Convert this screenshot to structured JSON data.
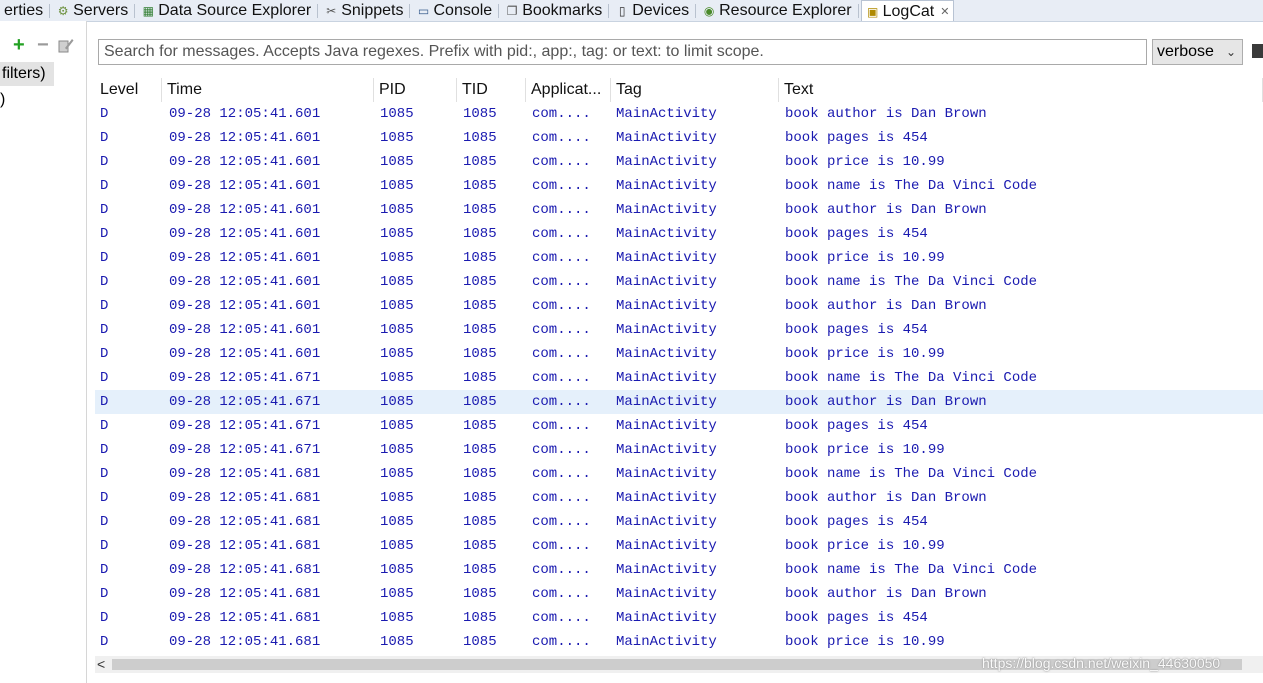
{
  "tabs": [
    {
      "label": "erties",
      "icon": "properties-icon"
    },
    {
      "label": "Servers",
      "icon": "servers-icon"
    },
    {
      "label": "Data Source Explorer",
      "icon": "data-source-icon"
    },
    {
      "label": "Snippets",
      "icon": "snippets-icon"
    },
    {
      "label": "Console",
      "icon": "console-icon"
    },
    {
      "label": "Bookmarks",
      "icon": "bookmarks-icon"
    },
    {
      "label": "Devices",
      "icon": "devices-icon"
    },
    {
      "label": "Resource Explorer",
      "icon": "resource-explorer-icon"
    },
    {
      "label": "LogCat",
      "icon": "logcat-icon",
      "active": true,
      "close": "✕"
    }
  ],
  "left_pane": {
    "add_label": "+",
    "remove_label": "−",
    "filters": [
      " filters)",
      ")"
    ]
  },
  "search": {
    "placeholder": "Search for messages. Accepts Java regexes. Prefix with pid:, app:, tag: or text: to limit scope."
  },
  "level_select": {
    "value": "verbose",
    "options": [
      "verbose"
    ]
  },
  "table": {
    "columns": [
      "Level",
      "Time",
      "PID",
      "TID",
      "Applicat...",
      "Tag",
      "Text"
    ],
    "selected_row": 12,
    "rows": [
      [
        "D",
        "09-28 12:05:41.601",
        "1085",
        "1085",
        "com....",
        "MainActivity",
        "book author is Dan Brown"
      ],
      [
        "D",
        "09-28 12:05:41.601",
        "1085",
        "1085",
        "com....",
        "MainActivity",
        "book pages is 454"
      ],
      [
        "D",
        "09-28 12:05:41.601",
        "1085",
        "1085",
        "com....",
        "MainActivity",
        "book price is 10.99"
      ],
      [
        "D",
        "09-28 12:05:41.601",
        "1085",
        "1085",
        "com....",
        "MainActivity",
        "book name is The Da Vinci Code"
      ],
      [
        "D",
        "09-28 12:05:41.601",
        "1085",
        "1085",
        "com....",
        "MainActivity",
        "book author is Dan Brown"
      ],
      [
        "D",
        "09-28 12:05:41.601",
        "1085",
        "1085",
        "com....",
        "MainActivity",
        "book pages is 454"
      ],
      [
        "D",
        "09-28 12:05:41.601",
        "1085",
        "1085",
        "com....",
        "MainActivity",
        "book price is 10.99"
      ],
      [
        "D",
        "09-28 12:05:41.601",
        "1085",
        "1085",
        "com....",
        "MainActivity",
        "book name is The Da Vinci Code"
      ],
      [
        "D",
        "09-28 12:05:41.601",
        "1085",
        "1085",
        "com....",
        "MainActivity",
        "book author is Dan Brown"
      ],
      [
        "D",
        "09-28 12:05:41.601",
        "1085",
        "1085",
        "com....",
        "MainActivity",
        "book pages is 454"
      ],
      [
        "D",
        "09-28 12:05:41.601",
        "1085",
        "1085",
        "com....",
        "MainActivity",
        "book price is 10.99"
      ],
      [
        "D",
        "09-28 12:05:41.671",
        "1085",
        "1085",
        "com....",
        "MainActivity",
        "book name is The Da Vinci Code"
      ],
      [
        "D",
        "09-28 12:05:41.671",
        "1085",
        "1085",
        "com....",
        "MainActivity",
        "book author is Dan Brown"
      ],
      [
        "D",
        "09-28 12:05:41.671",
        "1085",
        "1085",
        "com....",
        "MainActivity",
        "book pages is 454"
      ],
      [
        "D",
        "09-28 12:05:41.671",
        "1085",
        "1085",
        "com....",
        "MainActivity",
        "book price is 10.99"
      ],
      [
        "D",
        "09-28 12:05:41.681",
        "1085",
        "1085",
        "com....",
        "MainActivity",
        "book name is The Da Vinci Code"
      ],
      [
        "D",
        "09-28 12:05:41.681",
        "1085",
        "1085",
        "com....",
        "MainActivity",
        "book author is Dan Brown"
      ],
      [
        "D",
        "09-28 12:05:41.681",
        "1085",
        "1085",
        "com....",
        "MainActivity",
        "book pages is 454"
      ],
      [
        "D",
        "09-28 12:05:41.681",
        "1085",
        "1085",
        "com....",
        "MainActivity",
        "book price is 10.99"
      ],
      [
        "D",
        "09-28 12:05:41.681",
        "1085",
        "1085",
        "com....",
        "MainActivity",
        "book name is The Da Vinci Code"
      ],
      [
        "D",
        "09-28 12:05:41.681",
        "1085",
        "1085",
        "com....",
        "MainActivity",
        "book author is Dan Brown"
      ],
      [
        "D",
        "09-28 12:05:41.681",
        "1085",
        "1085",
        "com....",
        "MainActivity",
        "book pages is 454"
      ],
      [
        "D",
        "09-28 12:05:41.681",
        "1085",
        "1085",
        "com....",
        "MainActivity",
        "book price is 10.99"
      ]
    ]
  },
  "scrollbar": {
    "left_arrow": "<"
  },
  "watermark": "https://blog.csdn.net/weixin_44630050",
  "colors": {
    "log_text": "#1a1ab0",
    "selected_row": "#e5f0fb",
    "add_icon": "#23a123"
  }
}
